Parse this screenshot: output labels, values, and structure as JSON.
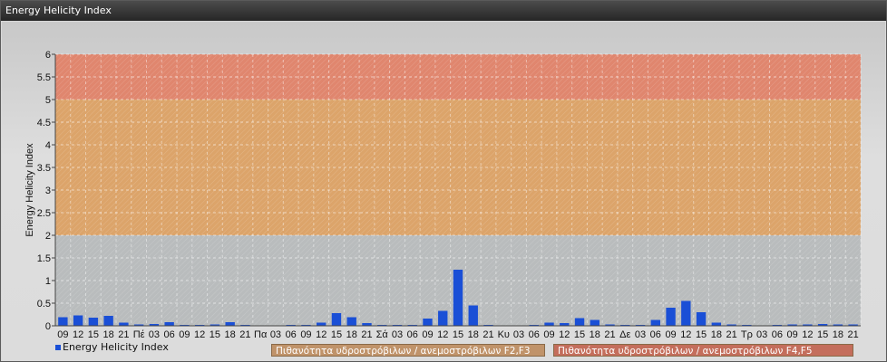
{
  "window": {
    "title": "Energy Helicity Index"
  },
  "legend": {
    "series_label": "Energy Helicity Index",
    "risk_low_label": "Πιθανότητα υδροστρόβιλων / ανεμοστρόβιλων F2,F3",
    "risk_high_label": "Πιθανότητα υδροστρόβιλων / ανεμοστρόβιλων F4,F5"
  },
  "colors": {
    "bar": "#1a4fd6",
    "band_low": "#b9bcbd",
    "band_mid": "#dca46a",
    "band_high": "#e0866e",
    "risk_low_box": "#c0936a",
    "risk_high_box": "#c46e5c"
  },
  "chart_data": {
    "type": "bar",
    "ylabel": "Energy Helicity Index",
    "ylim": [
      0,
      6
    ],
    "yticks": [
      "0",
      "0.5",
      "1",
      "1.5",
      "2",
      "2.5",
      "3",
      "3.5",
      "4",
      "4.5",
      "5",
      "5.5",
      "6"
    ],
    "bands": [
      {
        "from": 0,
        "to": 2,
        "color": "#b9bcbd"
      },
      {
        "from": 2,
        "to": 5,
        "color": "#dca46a"
      },
      {
        "from": 5,
        "to": 6,
        "color": "#e0866e"
      }
    ],
    "categories": [
      "09",
      "12",
      "15",
      "18",
      "21",
      "Πέ",
      "03",
      "06",
      "09",
      "12",
      "15",
      "18",
      "21",
      "Πα",
      "03",
      "06",
      "09",
      "12",
      "15",
      "18",
      "21",
      "Σά",
      "03",
      "06",
      "09",
      "12",
      "15",
      "18",
      "21",
      "Κυ",
      "03",
      "06",
      "09",
      "12",
      "15",
      "18",
      "21",
      "Δε",
      "03",
      "06",
      "09",
      "12",
      "15",
      "18",
      "21",
      "Τρ",
      "03",
      "06",
      "09",
      "12",
      "15",
      "18",
      "21"
    ],
    "series": [
      {
        "name": "Energy Helicity Index",
        "values": [
          0.19,
          0.23,
          0.18,
          0.22,
          0.07,
          0.03,
          0.04,
          0.08,
          0.02,
          0.02,
          0.03,
          0.08,
          0.02,
          0.01,
          0.01,
          0.02,
          0.02,
          0.07,
          0.28,
          0.19,
          0.06,
          0.02,
          0.02,
          0.02,
          0.16,
          0.33,
          1.24,
          0.45,
          0.02,
          0.01,
          0.01,
          0.02,
          0.07,
          0.06,
          0.17,
          0.13,
          0.03,
          0.02,
          0.02,
          0.13,
          0.4,
          0.55,
          0.3,
          0.07,
          0.03,
          0.02,
          0.01,
          0.02,
          0.03,
          0.03,
          0.04,
          0.03,
          0.03
        ]
      }
    ]
  }
}
